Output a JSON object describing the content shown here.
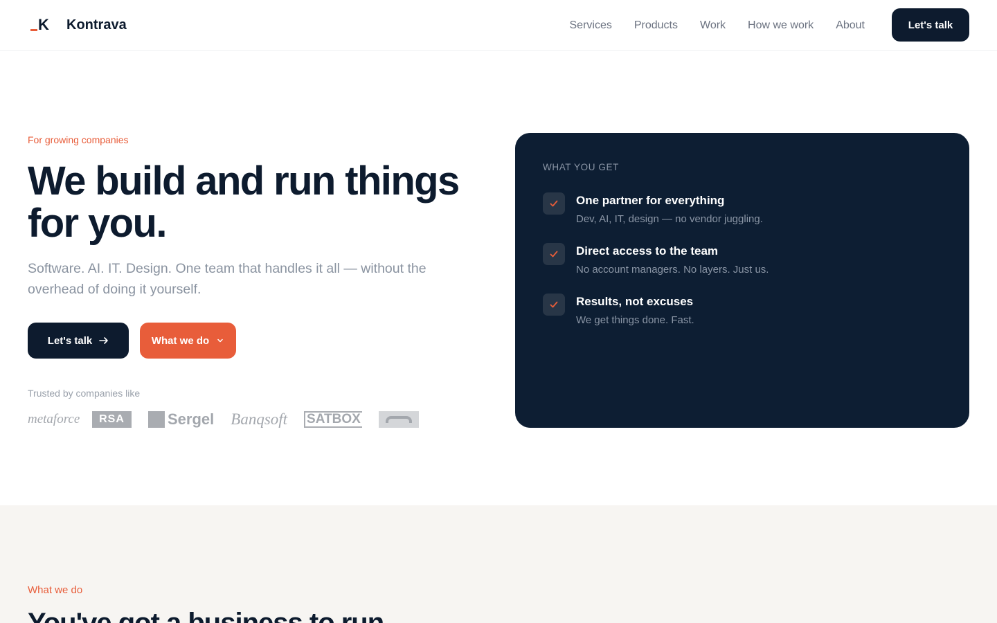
{
  "header": {
    "brand": "Kontrava",
    "logo_letter": "K",
    "nav": [
      "Services",
      "Products",
      "Work",
      "How we work",
      "About"
    ],
    "cta_label": "Let's talk"
  },
  "hero": {
    "eyebrow": "For growing companies",
    "title": "We build and run things for you.",
    "subtitle": "Software. AI. IT. Design. One team that handles it all — without the overhead of doing it yourself.",
    "primary_button": "Let's talk",
    "secondary_button": "What we do",
    "trusted_label": "Trusted by companies like",
    "client_logos": [
      "metaforce",
      "RSA",
      "Sergel",
      "Banqsoft",
      "SATBOX"
    ]
  },
  "card": {
    "label": "WHAT YOU GET",
    "benefits": [
      {
        "title": "One partner for everything",
        "desc": "Dev, AI, IT, design — no vendor juggling."
      },
      {
        "title": "Direct access to the team",
        "desc": "No account managers. No layers. Just us."
      },
      {
        "title": "Results, not excuses",
        "desc": "We get things done. Fast."
      }
    ]
  },
  "section": {
    "eyebrow": "What we do",
    "title": "You've got a business to run."
  },
  "colors": {
    "navy": "#0d1b2e",
    "accent": "#e85d3a",
    "card_bg": "#0d1e33",
    "section_bg": "#f7f5f2"
  },
  "icons": {
    "arrow": "arrow-right-icon",
    "chevron": "chevron-down-icon",
    "check": "check-icon"
  }
}
